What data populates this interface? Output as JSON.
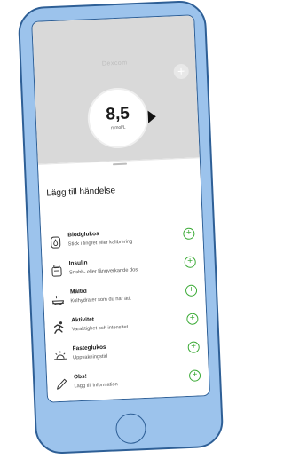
{
  "app": {
    "brand": "Dexcom",
    "glucose_value": "8,5",
    "glucose_unit": "mmol/L"
  },
  "sheet": {
    "title": "Lägg till händelse",
    "items": [
      {
        "title": "Blodglukos",
        "subtitle": "Stick i fingret eller kalibrering",
        "icon": "blood-drop-icon"
      },
      {
        "title": "Insulin",
        "subtitle": "Snabb- eller långverkande dos",
        "icon": "insulin-pen-icon"
      },
      {
        "title": "Måltid",
        "subtitle": "Kolhydrater som du har ätit",
        "icon": "meal-icon"
      },
      {
        "title": "Aktivitet",
        "subtitle": "Varaktighet och intensitet",
        "icon": "running-person-icon"
      },
      {
        "title": "Fasteglukos",
        "subtitle": "Uppvakningstid",
        "icon": "sunrise-icon"
      },
      {
        "title": "Obs!",
        "subtitle": "Lägg till information",
        "icon": "pencil-icon"
      }
    ]
  },
  "colors": {
    "phone_body": "#9cc3ec",
    "phone_outline": "#2e5f96",
    "add_green": "#3aaa35"
  }
}
